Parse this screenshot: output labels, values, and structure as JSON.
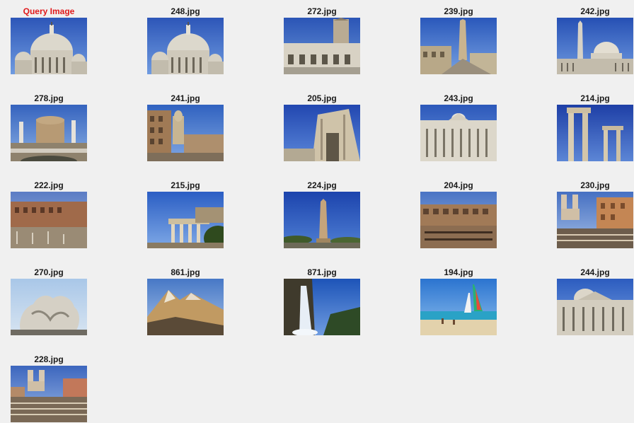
{
  "window": {
    "background": "#f0f0f0"
  },
  "query": {
    "title": "Query Image",
    "title_color": "#e0191b",
    "subject": "st-peters-dome"
  },
  "results": [
    {
      "title": "248.jpg",
      "subject": "st-peters-dome"
    },
    {
      "title": "272.jpg",
      "subject": "basilica-facade-with-tower"
    },
    {
      "title": "239.jpg",
      "subject": "obelisk-and-ruins"
    },
    {
      "title": "242.jpg",
      "subject": "st-peters-square"
    },
    {
      "title": "278.jpg",
      "subject": "castel-sant-angelo"
    },
    {
      "title": "241.jpg",
      "subject": "piazza-with-church"
    },
    {
      "title": "205.jpg",
      "subject": "triumphal-arch"
    },
    {
      "title": "243.jpg",
      "subject": "st-peters-facade"
    },
    {
      "title": "214.jpg",
      "subject": "forum-columns"
    },
    {
      "title": "222.jpg",
      "subject": "trajan-markets"
    },
    {
      "title": "215.jpg",
      "subject": "temple-ruins"
    },
    {
      "title": "224.jpg",
      "subject": "obelisk-in-park"
    },
    {
      "title": "204.jpg",
      "subject": "colosseum-interior"
    },
    {
      "title": "230.jpg",
      "subject": "spanish-steps-crowd"
    },
    {
      "title": "270.jpg",
      "subject": "marble-sculpture"
    },
    {
      "title": "861.jpg",
      "subject": "mountain-landscape"
    },
    {
      "title": "871.jpg",
      "subject": "waterfall"
    },
    {
      "title": "194.jpg",
      "subject": "beach-sailboats"
    },
    {
      "title": "244.jpg",
      "subject": "basilica-dome-facade"
    },
    {
      "title": "228.jpg",
      "subject": "spanish-steps-piazza"
    }
  ]
}
